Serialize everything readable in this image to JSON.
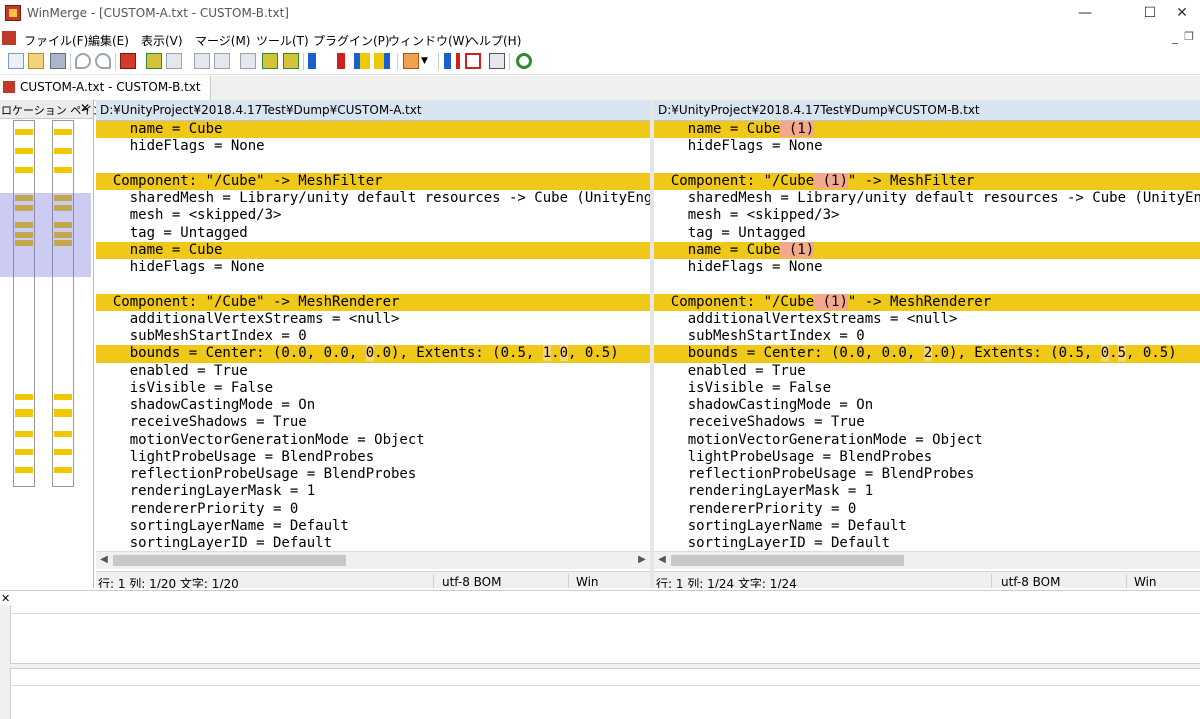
{
  "window": {
    "title": "WinMerge - [CUSTOM-A.txt - CUSTOM-B.txt]",
    "minimize": "—",
    "maximize": "☐",
    "close": "✕",
    "mdi_minimize": "_",
    "mdi_restore": "❐"
  },
  "menu": [
    "ファイル(F)",
    "編集(E)",
    "表示(V)",
    "マージ(M)",
    "ツール(T)",
    "プラグイン(P)",
    "ウィンドウ(W)",
    "ヘルプ(H)"
  ],
  "tab": {
    "label": "CUSTOM-A.txt - CUSTOM-B.txt"
  },
  "location_pane": {
    "title": "ロケーション ペイン",
    "close": "✕"
  },
  "left": {
    "path": "D:¥UnityProject¥2018.4.17Test¥Dump¥CUSTOM-A.txt",
    "lines": [
      "    name = Cube",
      "    hideFlags = None",
      "",
      "  Component: \"/Cube\" -> MeshFilter",
      "    sharedMesh = Library/unity default resources -> Cube (UnityEngine.Mesh)",
      "    mesh = <skipped/3>",
      "    tag = Untagged",
      "    name = Cube",
      "    hideFlags = None",
      "",
      "  Component: \"/Cube\" -> MeshRenderer",
      "    additionalVertexStreams = <null>",
      "    subMeshStartIndex = 0",
      "    bounds = Center: (0.0, 0.0, 0.0), Extents: (0.5, 1.0, 0.5)",
      "    enabled = True",
      "    isVisible = False",
      "    shadowCastingMode = On",
      "    receiveShadows = True",
      "    motionVectorGenerationMode = Object",
      "    lightProbeUsage = BlendProbes",
      "    reflectionProbeUsage = BlendProbes",
      "    renderingLayerMask = 1",
      "    rendererPriority = 0",
      "    sortingLayerName = Default",
      "    sortingLayerID = Default"
    ],
    "status": {
      "pos": "行: 1  列: 1/20  文字: 1/20",
      "encoding": "utf-8 BOM",
      "eol": "Win"
    }
  },
  "right": {
    "path": "D:¥UnityProject¥2018.4.17Test¥Dump¥CUSTOM-B.txt",
    "lines": [
      "    name = Cube (1)",
      "    hideFlags = None",
      "",
      "  Component: \"/Cube (1)\" -> MeshFilter",
      "    sharedMesh = Library/unity default resources -> Cube (UnityEngine.Mesh)",
      "    mesh = <skipped/3>",
      "    tag = Untagged",
      "    name = Cube (1)",
      "    hideFlags = None",
      "",
      "  Component: \"/Cube (1)\" -> MeshRenderer",
      "    additionalVertexStreams = <null>",
      "    subMeshStartIndex = 0",
      "    bounds = Center: (0.0, 0.0, 2.0), Extents: (0.5, 0.5, 0.5)",
      "    enabled = True",
      "    isVisible = False",
      "    shadowCastingMode = On",
      "    receiveShadows = True",
      "    motionVectorGenerationMode = Object",
      "    lightProbeUsage = BlendProbes",
      "    reflectionProbeUsage = BlendProbes",
      "    renderingLayerMask = 1",
      "    rendererPriority = 0",
      "    sortingLayerName = Default",
      "    sortingLayerID = Default"
    ],
    "status": {
      "pos": "行: 1  列: 1/24  文字: 1/24",
      "encoding": "utf-8 BOM",
      "eol": "Win"
    }
  },
  "diff_rows": [
    0,
    3,
    7,
    10,
    13
  ],
  "colors": {
    "diff": "#efc818",
    "word_diff": "#f4a88c",
    "header": "#d9e4f1"
  },
  "bottom_pane": {
    "close": "✕"
  }
}
